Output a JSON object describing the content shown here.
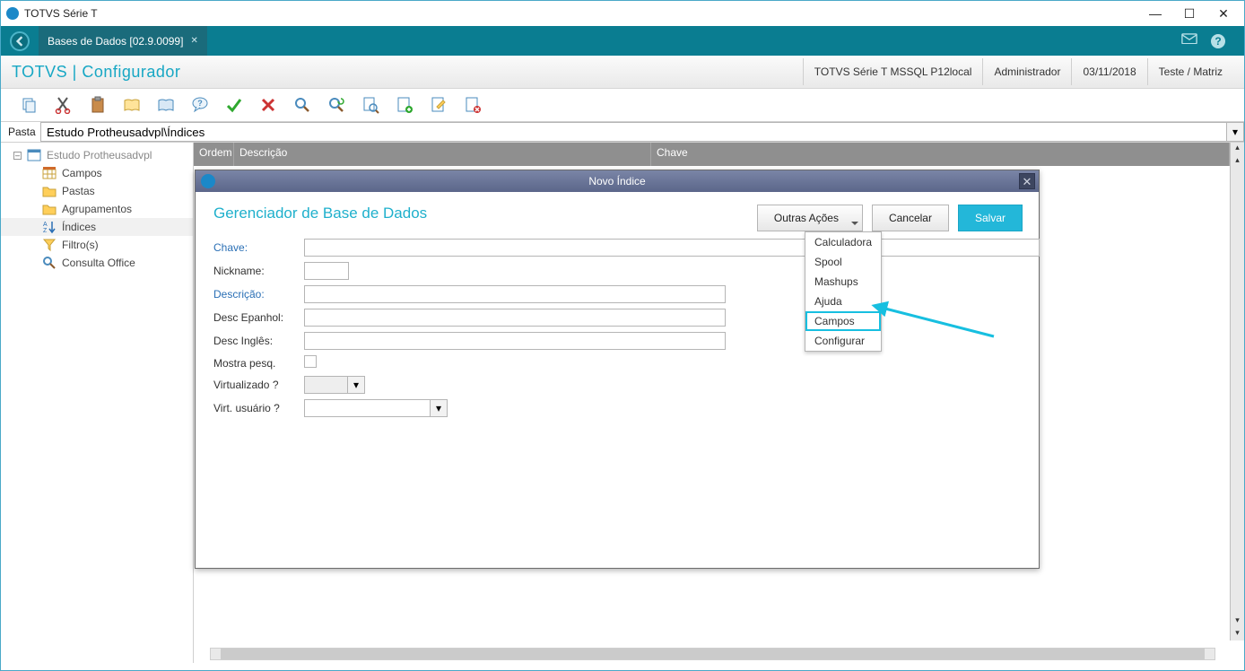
{
  "window": {
    "title": "TOTVS Série T"
  },
  "tabstrip": {
    "tab_label": "Bases de Dados [02.9.0099]"
  },
  "brand": "TOTVS | Configurador",
  "status": {
    "env": "TOTVS Série T  MSSQL P12local",
    "user": "Administrador",
    "date": "03/11/2018",
    "branch": "Teste / Matriz"
  },
  "path": {
    "label": "Pasta",
    "value": "Estudo Protheusadvpl\\Índices"
  },
  "tree": {
    "root": "Estudo Protheusadvpl",
    "items": [
      "Campos",
      "Pastas",
      "Agrupamentos",
      "Índices",
      "Filtro(s)",
      "Consulta Office"
    ],
    "selected": "Índices"
  },
  "grid": {
    "cols": [
      "Ordem",
      "Descrição",
      "Chave"
    ]
  },
  "modal": {
    "title": "Novo Índice",
    "heading": "Gerenciador de Base de Dados",
    "other_actions": "Outras Ações",
    "cancel": "Cancelar",
    "save": "Salvar",
    "fields": {
      "chave": "Chave:",
      "nickname": "Nickname:",
      "descricao": "Descrição:",
      "desc_es": "Desc Epanhol:",
      "desc_en": "Desc Inglês:",
      "mostra": "Mostra pesq.",
      "virtualizado": "Virtualizado ?",
      "virt_usuario": "Virt. usuário ?"
    },
    "menu": [
      "Calculadora",
      "Spool",
      "Mashups",
      "Ajuda",
      "Campos",
      "Configurar"
    ],
    "menu_highlight": "Campos"
  }
}
